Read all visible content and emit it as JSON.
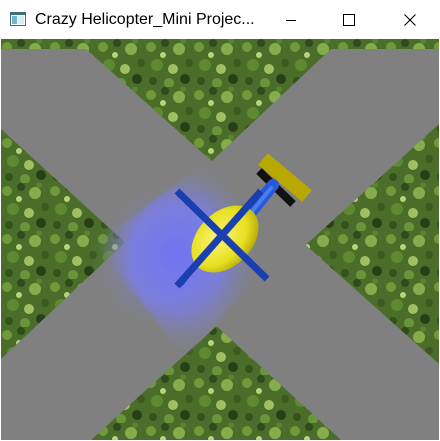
{
  "window": {
    "title": "Crazy Helicopter_Mini Projec...",
    "icon": "app-window-icon",
    "controls": {
      "minimize_icon": "minimize-icon",
      "maximize_icon": "maximize-icon",
      "close_icon": "close-icon"
    }
  },
  "scene": {
    "colors": {
      "grass_base": "#4a6e2a",
      "road": "#808080",
      "helicopter_body": "#e8e020",
      "rotor": "#1a3fb0",
      "tail": "#2858d8",
      "tail_rotor": "#b8a800",
      "searchlight": "#6e72f2"
    }
  }
}
